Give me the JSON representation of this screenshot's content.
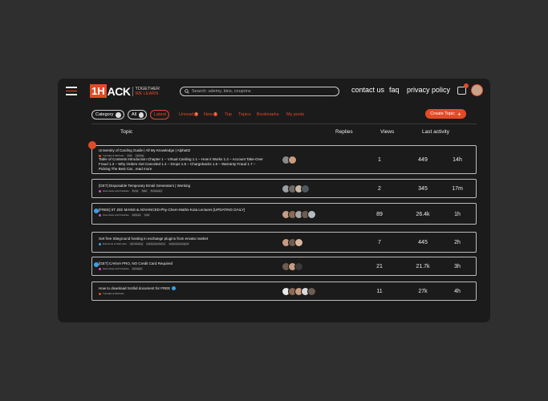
{
  "colors": {
    "accent": "#e24b26",
    "window": "#1b1b1b",
    "background": "#2f2f2f",
    "verified": "#3aa0e6"
  },
  "header": {
    "logo": {
      "mark": "1H",
      "word": "ACK",
      "tag1": "TOGETHER",
      "tag2": "WE LEARN"
    },
    "search_placeholder": "Search: udemy, bins, coupons",
    "nav": [
      "contact us",
      "faq",
      "privacy policy"
    ],
    "icons": [
      "menu-icon",
      "search-icon",
      "chat-icon",
      "avatar"
    ]
  },
  "filters": {
    "category": "Category",
    "all": "All",
    "latest": "Latest",
    "unread": "Unread",
    "unread_count": "9",
    "new": "New",
    "new_count": "7",
    "top": "Top",
    "topics": "Topics",
    "bookmarks": "Bookmarks",
    "myposts": "My posts",
    "create": "Create Topic",
    "create_icon": "+"
  },
  "columns": {
    "topic": "Topic",
    "replies": "Replies",
    "views": "Views",
    "activity": "Last activity"
  },
  "topics": [
    {
      "lines": [
        "University of Carding Guide | All My Knowledge | Alpha02",
        "Table of Contents Introduction Chapter 1 – Virtual Carding 1.1 – How it Works 1.2 – Account Take-Over Fraud 1.3 – Why Orders Get Canceled 1.4 – Drops 1.5 – Chargebacks 1.6 – Warranty Fraud 1.7 – Picking The Best Car...",
        "read more"
      ],
      "category": "Tutorials & Methods",
      "tags": [
        "crds",
        "carding"
      ],
      "replies": "1",
      "views": "449",
      "activity": "14h"
    },
    {
      "lines": [
        "[GET] Disposable Temporary Email Generators | Working"
      ],
      "category": "Give-Away and Freebies",
      "tags": [
        "Temp",
        "Mail",
        "Temporary"
      ],
      "replies": "2",
      "views": "345",
      "activity": "17m"
    },
    {
      "lines": [
        "[FREE] IIT JEE MAINS & ADVANCED-Phy-Chem-Maths-Kota Lectures [UPDATING DAILY]"
      ],
      "category": "Give-Away and Freebies",
      "tags": [
        "lectures",
        "kota"
      ],
      "replies": "89",
      "views": "26.4k",
      "activity": "1h"
    },
    {
      "lines": [
        "Get free Siteground hosting in exchange plugins from envato market"
      ],
      "category": "Discounts & Sold Here",
      "tags": [
        "site-hosting",
        "wordpress-theme",
        "wordpress-plugins"
      ],
      "replies": "7",
      "views": "445",
      "activity": "2h"
    },
    {
      "lines": [
        "[GET] CANVA PRO, NO Credit Card Required"
      ],
      "category": "Give-Away and Freebies",
      "tags": [
        "canvapro"
      ],
      "replies": "21",
      "views": "21.7k",
      "activity": "3h"
    },
    {
      "lines": [
        "How to download Scribd document for FREE"
      ],
      "category": "Tutorials & Methods",
      "tags": [],
      "replies": "11",
      "views": "27k",
      "activity": "4h"
    }
  ]
}
